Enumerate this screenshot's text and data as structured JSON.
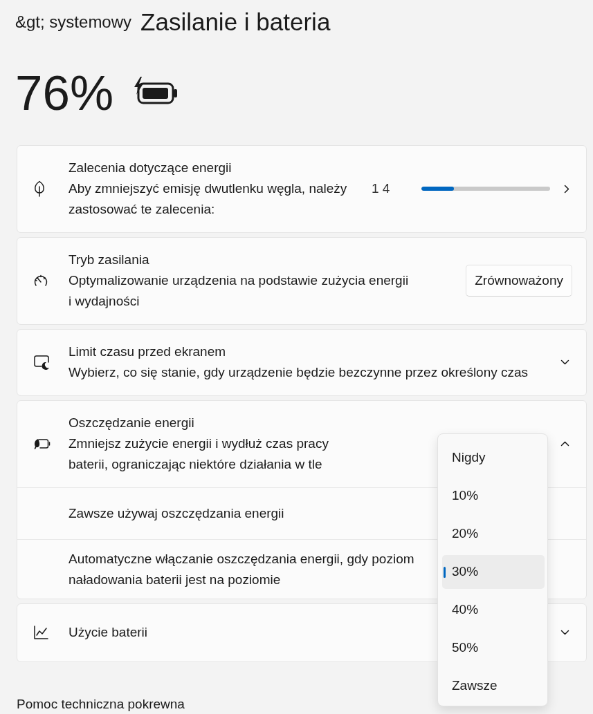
{
  "header": {
    "breadcrumb": "&gt; systemowy",
    "title": "Zasilanie i bateria"
  },
  "battery": {
    "percent": "76%"
  },
  "cards": [
    {
      "kind": "progress",
      "title": "Zalecenia dotyczące energii",
      "description": "Aby zmniejszyć emisję dwutlenku węgla, należy zastosować te zalecenia:",
      "count": "1 4",
      "level": 0.25
    },
    {
      "kind": "select",
      "title": "Tryb zasilania",
      "description": "Optymalizowanie urządzenia na podstawie zużycia energii i wydajności",
      "value": "Zrównoważony"
    },
    {
      "kind": "expander",
      "title": "Limit czasu przed ekranem",
      "description": "Wybierz, co się stanie, gdy urządzenie będzie bezczynne przez określony czas",
      "expanded": false
    },
    {
      "kind": "expander",
      "title": "Oszczędzanie energii",
      "description": "Zmniejsz zużycie energii i wydłuż czas pracy baterii, ograniczając niektóre działania w tle",
      "expanded": true,
      "children": [
        {
          "label": "Zawsze używaj oszczędzania energii"
        },
        {
          "label": "Automatyczne włączanie oszczędzania energii, gdy poziom naładowania baterii jest na poziomie",
          "dropdown": {
            "options": [
              {
                "label": "Nigdy",
                "selected": false
              },
              {
                "label": "10%",
                "selected": false
              },
              {
                "label": "20%",
                "selected": false
              },
              {
                "label": "30%",
                "selected": true
              },
              {
                "label": "40%",
                "selected": false
              },
              {
                "label": "50%",
                "selected": false
              },
              {
                "label": "Zawsze",
                "selected": false
              }
            ]
          }
        }
      ]
    },
    {
      "kind": "expander",
      "title": "Użycie baterii",
      "expanded": false
    }
  ],
  "footer": "Pomoc techniczna pokrewna"
}
